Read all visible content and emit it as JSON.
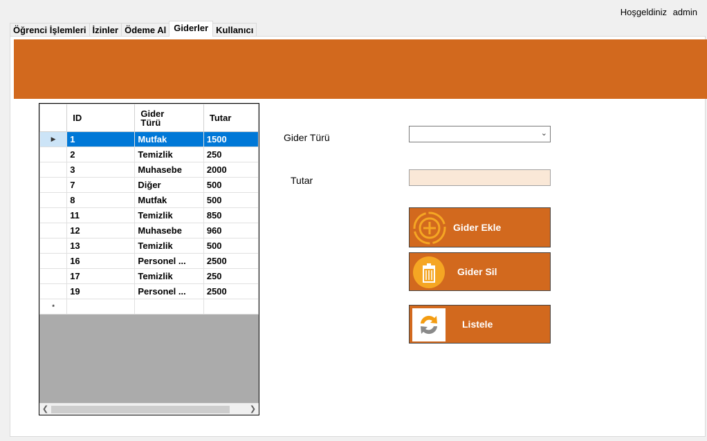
{
  "header": {
    "welcome": "Hoşgeldiniz",
    "user": "admin"
  },
  "tabs": [
    {
      "label": "Öğrenci İşlemleri"
    },
    {
      "label": "İzinler"
    },
    {
      "label": "Ödeme Al"
    },
    {
      "label": "Giderler"
    },
    {
      "label": "Kullanıcı"
    }
  ],
  "active_tab": "Giderler",
  "colors": {
    "accent": "#d2691e",
    "selection": "#0078d7",
    "tutar_bg": "#fae8d7",
    "icon_yellow": "#f5a623"
  },
  "grid": {
    "columns": [
      "ID",
      "Gider Türü",
      "Tutar"
    ],
    "rows": [
      [
        "1",
        "Mutfak",
        "1500"
      ],
      [
        "2",
        "Temizlik",
        "250"
      ],
      [
        "3",
        "Muhasebe",
        "2000"
      ],
      [
        "7",
        "Diğer",
        "500"
      ],
      [
        "8",
        "Mutfak",
        "500"
      ],
      [
        "11",
        "Temizlik",
        "850"
      ],
      [
        "12",
        "Muhasebe",
        "960"
      ],
      [
        "13",
        "Temizlik",
        "500"
      ],
      [
        "16",
        "Personel ...",
        "2500"
      ],
      [
        "17",
        "Temizlik",
        "250"
      ],
      [
        "19",
        "Personel ...",
        "2500"
      ]
    ],
    "selected_row_index": 0,
    "current_row_marker": "▶",
    "new_row_marker": "*"
  },
  "form": {
    "gider_turu_label": "Gider Türü",
    "gider_turu_value": "",
    "tutar_label": "Tutar",
    "tutar_value": ""
  },
  "buttons": {
    "ekle": {
      "label": "Gider Ekle",
      "icon": "plus-circle-icon"
    },
    "sil": {
      "label": "Gider Sil",
      "icon": "trash-icon"
    },
    "listele": {
      "label": "Listele",
      "icon": "refresh-icon"
    }
  }
}
